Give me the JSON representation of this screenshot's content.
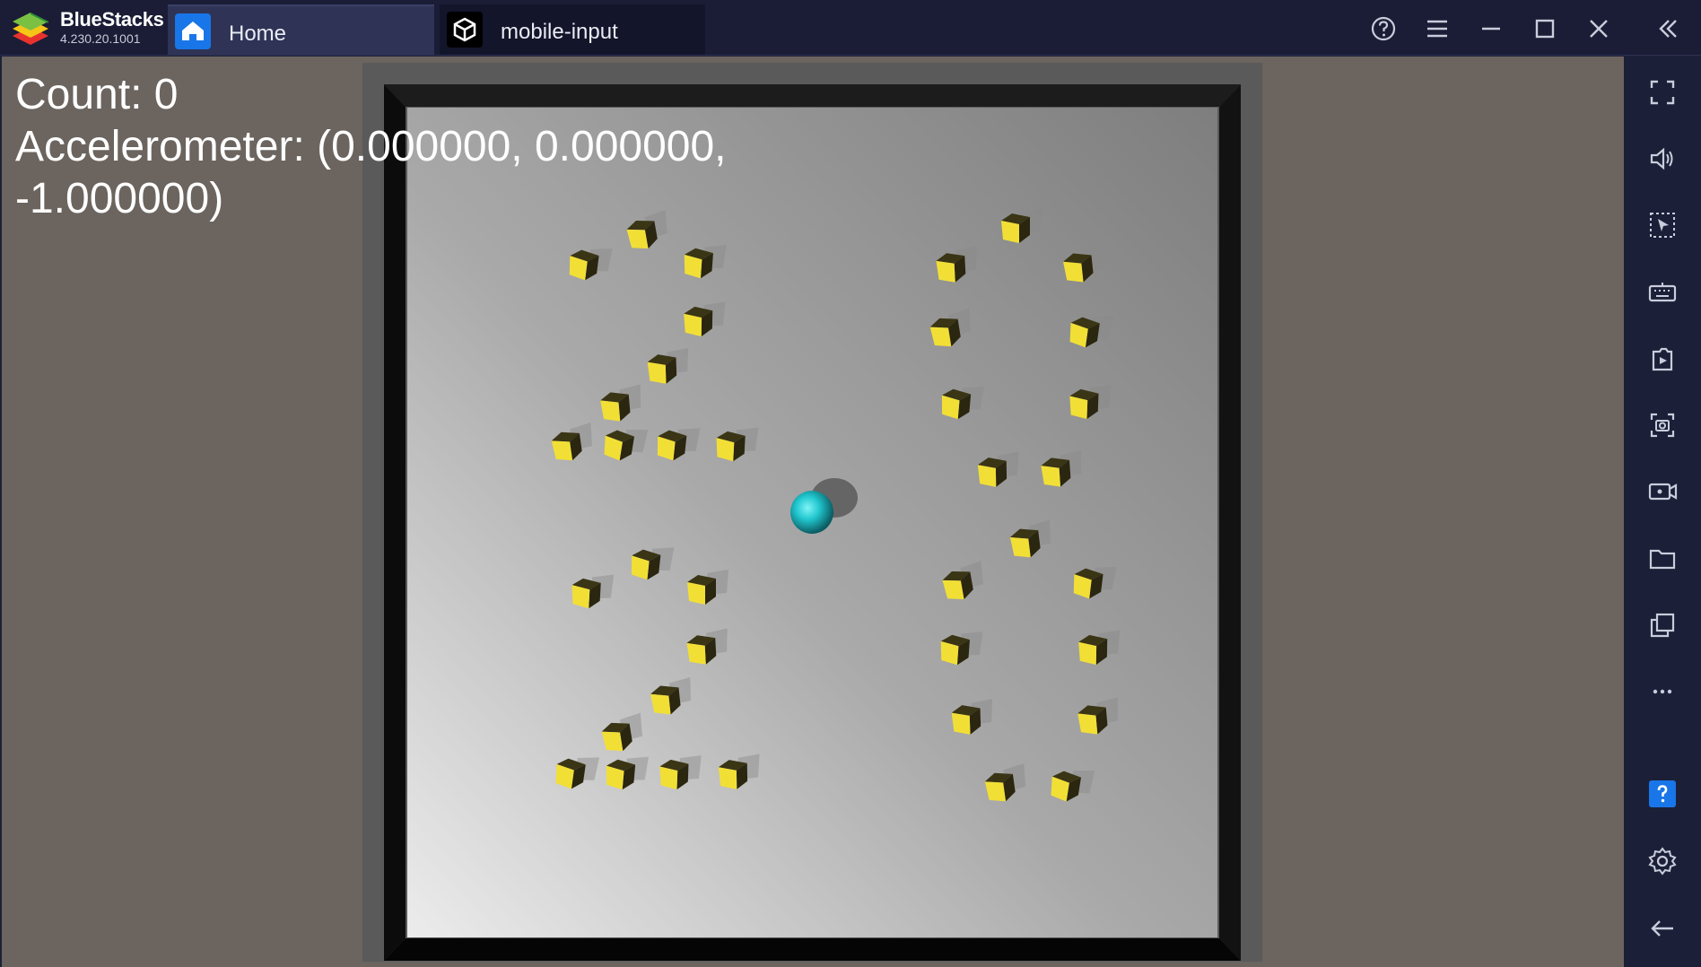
{
  "app": {
    "name": "BlueStacks",
    "version": "4.230.20.1001"
  },
  "tabs": [
    {
      "label": "Home",
      "icon": "home-icon",
      "active": false
    },
    {
      "label": "mobile-input",
      "icon": "unity-icon",
      "active": true
    }
  ],
  "window_controls": [
    "help-icon",
    "menu-icon",
    "minimize-icon",
    "maximize-icon",
    "close-icon",
    "collapse-sidebar-icon"
  ],
  "hud": {
    "count_text": "Count: 0",
    "accelerometer_line1": "Accelerometer: (0.000000, 0.000000,",
    "accelerometer_line2": "-1.000000)"
  },
  "sidebar_buttons": [
    "fullscreen-icon",
    "volume-icon",
    "pointer-icon",
    "keyboard-icon",
    "install-apk-icon",
    "screenshot-icon",
    "record-icon",
    "folder-icon",
    "multi-instance-icon",
    "more-icon",
    "help-icon",
    "settings-icon",
    "back-icon"
  ],
  "scene": {
    "ball_color": "#2fd3d8",
    "pickup_color": "#f2df36",
    "floor": "grey gradient",
    "pickups_collected": 0
  },
  "colors": {
    "titlebar": "#1a1d35",
    "active_tab": "#2f3456",
    "home_icon_bg": "#1976e8",
    "help_button": "#1976e8",
    "sidebar": "#1c1f38"
  }
}
